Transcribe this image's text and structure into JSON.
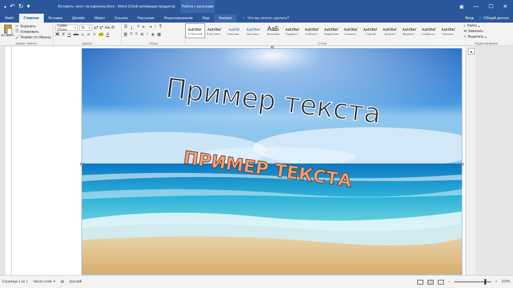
{
  "window": {
    "title": "Вставить текст на картинку.docx - Word (Сбой активации продукта)",
    "context_title": "Работа с рисунками",
    "sign_in": "Вход",
    "share": "Общий доступ"
  },
  "tabs": [
    {
      "label": "Файл"
    },
    {
      "label": "Главная"
    },
    {
      "label": "Вставка"
    },
    {
      "label": "Дизайн"
    },
    {
      "label": "Макет"
    },
    {
      "label": "Ссылки"
    },
    {
      "label": "Рассылки"
    },
    {
      "label": "Рецензирование"
    },
    {
      "label": "Вид"
    },
    {
      "label": "Формат"
    }
  ],
  "tell_me": "Что вы хотите сделать?",
  "ribbon": {
    "clipboard": {
      "paste": "Вставить",
      "cut": "Вырезать",
      "copy": "Копировать",
      "format_painter": "Формат по образцу",
      "label": "Буфер обмена"
    },
    "font": {
      "name": "Calibri (Осно",
      "size": "11",
      "label": "Шрифт"
    },
    "paragraph": {
      "label": "Абзац"
    },
    "styles": {
      "label": "Стили",
      "items": [
        {
          "sample": "АаБбВвГ",
          "name": "¶ Обычный"
        },
        {
          "sample": "АаБбВвГ",
          "name": "¶ Без инте..."
        },
        {
          "sample": "АаБбВ",
          "name": "Заголово..."
        },
        {
          "sample": "АаБбВвГ",
          "name": "Заголово..."
        },
        {
          "sample": "АаБ",
          "name": "Заголовок"
        },
        {
          "sample": "АаБбВвГ",
          "name": "Подзагол..."
        },
        {
          "sample": "АаБбВвГ",
          "name": "Слабое в..."
        },
        {
          "sample": "АаБбВвГ",
          "name": "Выделение"
        },
        {
          "sample": "АаБбВвГ",
          "name": "Сильное..."
        },
        {
          "sample": "АаБбВвГ",
          "name": "Строгий"
        },
        {
          "sample": "АаБбВвГ",
          "name": "Цитата 2"
        },
        {
          "sample": "АаБбВвГ",
          "name": "Выделен..."
        },
        {
          "sample": "АаБбВвГ",
          "name": "Слабая сс..."
        },
        {
          "sample": "АаБбВвГ",
          "name": "Сильная..."
        }
      ]
    },
    "editing": {
      "find": "Найти",
      "replace": "Заменить",
      "select": "Выделить",
      "label": "Редактирование"
    }
  },
  "picture": {
    "title_text": "Пример текста",
    "subtitle_text": "ПРИМЕР ТЕКСТА"
  },
  "status": {
    "page": "Страница 1 из 1",
    "words": "Число слов: 4",
    "language": "русский",
    "zoom": "220%"
  },
  "colors": {
    "accent": "#2b579a",
    "wordart_fill": "#f3a27a"
  }
}
